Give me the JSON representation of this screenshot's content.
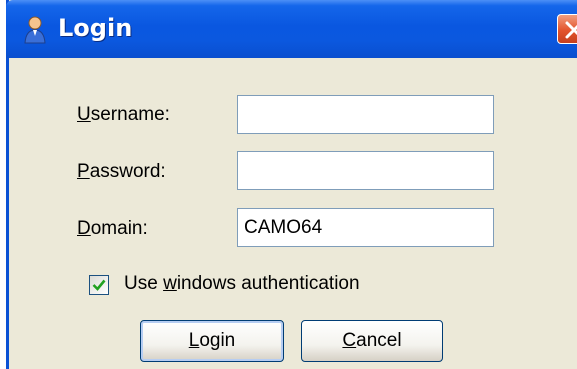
{
  "window": {
    "title": "Login",
    "icon": "user-icon",
    "close_icon": "close-icon"
  },
  "form": {
    "username": {
      "label_key": "U",
      "label_rest": "sername:",
      "value": ""
    },
    "password": {
      "label_key": "P",
      "label_rest": "assword:",
      "value": ""
    },
    "domain": {
      "label_key": "D",
      "label_rest": "omain:",
      "value": "CAMO64"
    },
    "windows_auth": {
      "checked": true,
      "label_pre": "Use ",
      "label_key": "w",
      "label_rest": "indows authentication"
    }
  },
  "buttons": {
    "login": {
      "key": "L",
      "rest": "ogin"
    },
    "cancel": {
      "key": "C",
      "rest": "ancel"
    }
  },
  "colors": {
    "titlebar": "#0a57e0",
    "window_bg": "#ece9d8",
    "close_button": "#e3542c",
    "checkmark": "#21a121"
  }
}
